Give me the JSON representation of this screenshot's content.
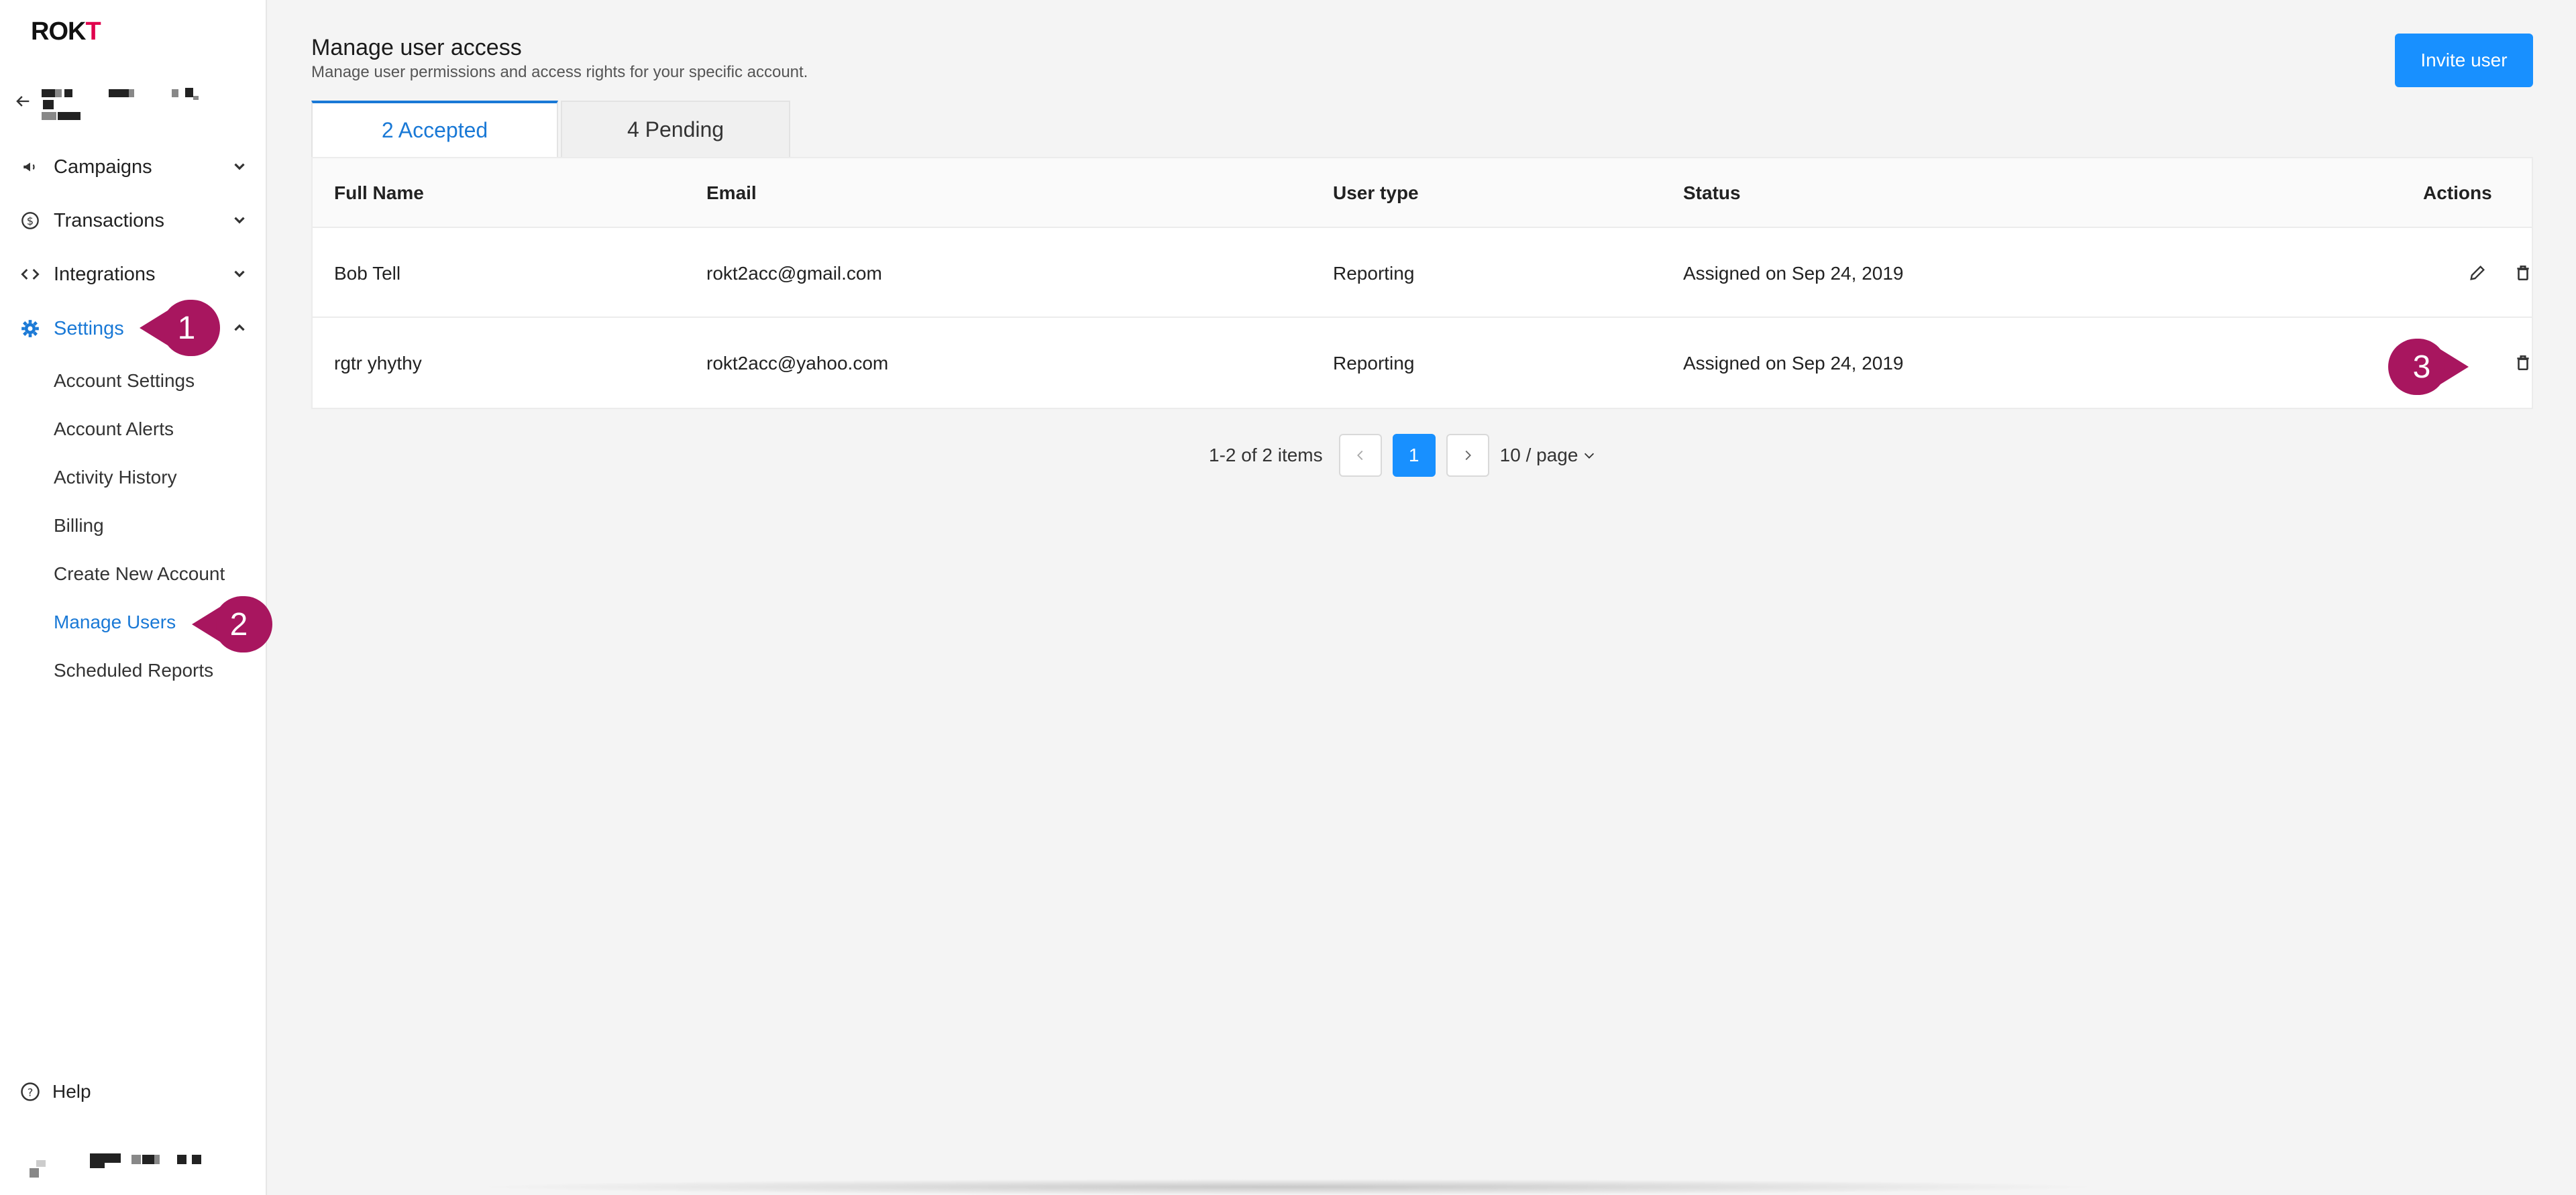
{
  "app": {
    "logo_text_pre": "ROK",
    "logo_text_accent": "T",
    "logo_accent_color": "#e0004d"
  },
  "sidebar": {
    "items": [
      {
        "label": "Campaigns",
        "icon": "megaphone-icon"
      },
      {
        "label": "Transactions",
        "icon": "dollar-circle-icon"
      },
      {
        "label": "Integrations",
        "icon": "code-icon"
      },
      {
        "label": "Settings",
        "icon": "gear-icon",
        "expanded": true
      }
    ],
    "settings_sub": [
      {
        "label": "Account Settings"
      },
      {
        "label": "Account Alerts"
      },
      {
        "label": "Activity History"
      },
      {
        "label": "Billing"
      },
      {
        "label": "Create New Account"
      },
      {
        "label": "Manage Users",
        "active": true
      },
      {
        "label": "Scheduled Reports"
      }
    ],
    "help_label": "Help"
  },
  "header": {
    "title": "Manage user access",
    "subtitle": "Manage user permissions and access rights for your specific account.",
    "invite_label": "Invite user"
  },
  "tabs": [
    {
      "label": "2 Accepted",
      "active": true
    },
    {
      "label": "4 Pending"
    }
  ],
  "table": {
    "columns": [
      "Full Name",
      "Email",
      "User type",
      "Status",
      "Actions"
    ],
    "rows": [
      {
        "name": "Bob Tell",
        "email": "rokt2acc@gmail.com",
        "type": "Reporting",
        "status": "Assigned on Sep 24, 2019"
      },
      {
        "name": "rgtr yhythy",
        "email": "rokt2acc@yahoo.com",
        "type": "Reporting",
        "status": "Assigned on Sep 24, 2019"
      }
    ]
  },
  "pagination": {
    "info": "1-2 of 2 items",
    "current_page": "1",
    "page_size": "10 / page"
  },
  "callouts": [
    "1",
    "2",
    "3"
  ],
  "colors": {
    "primary": "#1890ff",
    "active_text": "#1a79d6",
    "callout": "#a8165f"
  }
}
